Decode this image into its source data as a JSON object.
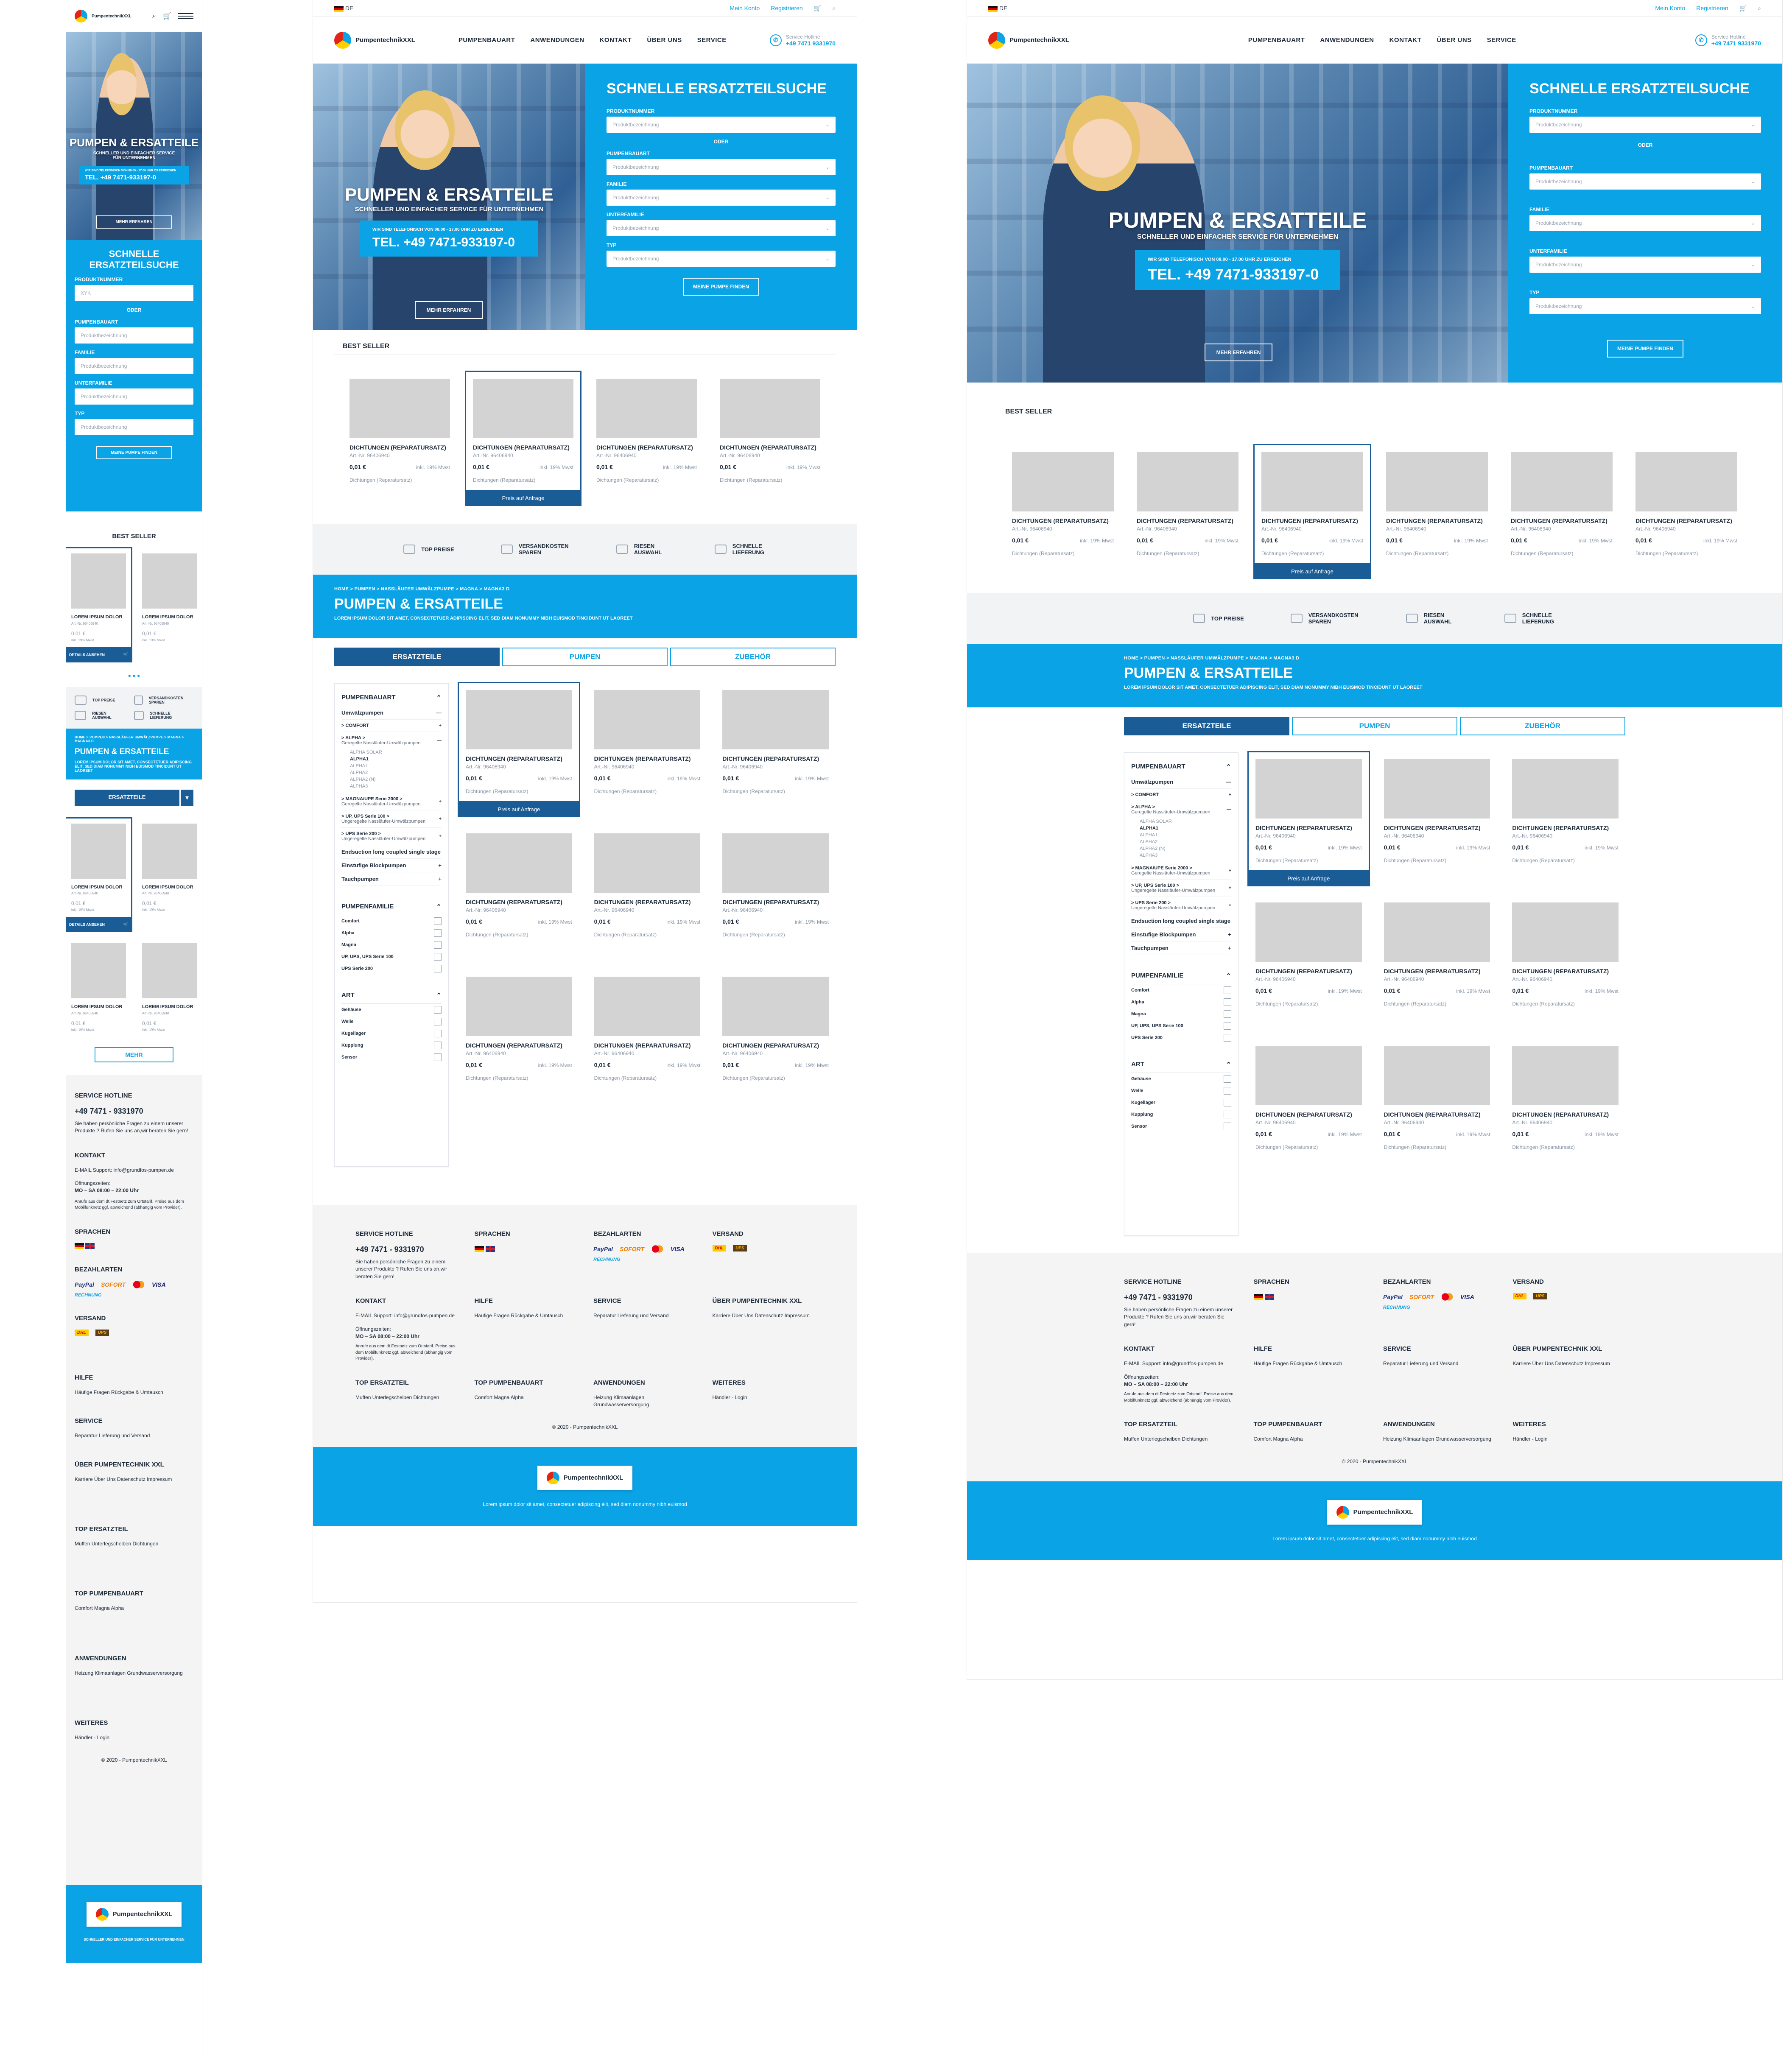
{
  "header": {
    "lang": "DE",
    "my_account": "Mein Konto",
    "register": "Registrieren",
    "brand": "PumpentechnikXXL",
    "nav": [
      "PUMPENBAUART",
      "ANWENDUNGEN",
      "KONTAKT",
      "ÜBER UNS",
      "SERVICE"
    ],
    "hotline_label": "Service Hotline",
    "hotline_number": "+49 7471 9331970"
  },
  "hero": {
    "title": "PUMPEN & ERSATTEILE",
    "subtitle": "SCHNELLER UND EINFACHER SERVICE FÜR UNTERNEHMEN",
    "call_note": "WIR SIND TELEFONISCH VON 08.00 - 17.00 UHR ZU ERREICHEN",
    "call_number": "TEL. +49 7471-933197-0",
    "more_button": "MEHR ERFAHREN"
  },
  "search": {
    "title": "SCHNELLE ERSATZTEILSUCHE",
    "mobile_title": "SCHNELLE ERSATZTEILSUCHE",
    "product_no_label": "PRODUKTNUMMER",
    "or": "ODER",
    "fields": [
      {
        "label": "PUMPENBAUART",
        "placeholder": "Produktbezeichnung"
      },
      {
        "label": "FAMILIE",
        "placeholder": "Produktbezeichnung"
      },
      {
        "label": "UNTERFAMILIE",
        "placeholder": "Produktbezeichnung"
      },
      {
        "label": "TYP",
        "placeholder": "Produktbezeichnung"
      }
    ],
    "placeholder": "Produktbezeichnung",
    "mobile_placeholder": "XYK",
    "button": "MEINE PUMPE FINDEN"
  },
  "bestseller": {
    "title": "BEST SELLER",
    "mobile_title": "BEST SELLER",
    "product": {
      "name": "DICHTUNGEN (REPARATURSATZ)",
      "article": "Art.-Nr. 96406940",
      "price": "0,01 €",
      "tax": "inkl. 19% Mwst",
      "category": "Dichtungen (Reparatursatz)",
      "request": "Preis auf Anfrage"
    },
    "mobile_product": {
      "name": "LOREM IPSUM DOLOR",
      "article": "Art.-Nr. 96406940",
      "price": "0,01 €",
      "tax": "inkl. 19% Mwst",
      "details": "DETAILS ANSEHEN"
    }
  },
  "usp": [
    "TOP PREISE",
    "VERSANDKOSTEN SPAREN",
    "RIESEN AUSWAHL",
    "SCHNELLE LIEFERUNG"
  ],
  "category": {
    "breadcrumb": "HOME > PUMPEN > NASSLÄUFER UMWÄLZPUMPE > MAGNA > MAGNA3 D",
    "title": "PUMPEN & ERSATTEILE",
    "text": "LOREM IPSUM DOLOR SIT AMET, CONSECTETUER ADIPISCING ELIT, SED DIAM NONUMMY NIBH EUISMOD TINCIDUNT UT LAOREET",
    "tabs": [
      "ERSATZTEILE",
      "PUMPEN",
      "ZUBEHÖR"
    ],
    "more": "MEHR"
  },
  "filters": {
    "pumpenbauart": "PUMPENBAUART",
    "umwalz": "Umwälzpumpen",
    "comfort": "> COMFORT",
    "alpha": "> ALPHA >",
    "alpha_sub": "Geregelte Nassläufer-Umwälzpumpen",
    "alpha_items": [
      "ALPHA SOLAR",
      "ALPHA1",
      "ALPHA L",
      "ALPHA2",
      "ALPHA2 (N)",
      "ALPHA3"
    ],
    "magna": "> MAGNA/UPE Serie 2000 >",
    "magna_sub": "Geregelte Nassläufer-Umwälzpumpen",
    "up100": "> UP, UPS Serie 100 >",
    "up100_sub": "Ungeregelte Nassläufer-Umwälzpumpen",
    "ups200": "> UPS Serie 200 >",
    "ups200_sub": "Ungeregelte Nassläufer-Umwälzpumpen",
    "endsuction": "Endsuction long coupled single stage",
    "einstufig": "Einstufige Blockpumpen",
    "tauch": "Tauchpumpen",
    "familie": "PUMPENFAMILIE",
    "familie_items": [
      "Comfort",
      "Alpha",
      "Magna",
      "UP, UPS, UPS Serie 100",
      "UPS Serie 200"
    ],
    "art": "ART",
    "art_items": [
      "Gehäuse",
      "Welle",
      "Kugellager",
      "Kupplung",
      "Sensor"
    ]
  },
  "footer": {
    "hotline_title": "SERVICE HOTLINE",
    "hotline": "+49 7471 - 9331970",
    "hotline_text": "Sie haben persönliche Fragen zu einem unserer Produkte ? Rufen Sie uns an,wir beraten Sie gern!",
    "languages": "SPRACHEN",
    "payment": "BEZAHLARTEN",
    "pay_items": [
      "PayPal",
      "SOFORT",
      "VISA",
      "RECHNUNG"
    ],
    "shipping": "VERSAND",
    "ship_items": [
      "DHL",
      "UPS"
    ],
    "contact_title": "KONTAKT",
    "contact_text": "E-MAIL Support: info@grundfos-pumpen.de",
    "hours_label": "Öffnungszeiten:",
    "hours": "MO – SA 08:00 – 22:00 Uhr",
    "hours_note": "Anrufe aus dem dt.Festnetz zum Ortstarif. Preise aus dem Mobilfunknetz ggf. abweichend (abhängig vom Provider).",
    "help_title": "HILFE",
    "help_items": "Häufige Fragen Rückgabe & Umtausch",
    "service_title": "SERVICE",
    "service_items": "Reparatur Lieferung und Versand",
    "about_title": "ÜBER PUMPENTECHNIK XXL",
    "about_items": "Karriere Über Uns Datenschutz Impressum",
    "top_spare": "TOP ERSATZTEIL",
    "top_spare_items": "Muffen Unterlegscheiben Dichtungen",
    "top_pump": "TOP PUMPENBAUART",
    "top_pump_items": "Comfort Magna Alpha",
    "apps": "ANWENDUNGEN",
    "apps_items": "Heizung Klimaanlagen Grundwasserversorgung",
    "more": "WEITERES",
    "more_items": "Händler - Login",
    "copyright": "© 2020 - PumpentechnikXXL",
    "band_text": "Lorem ipsum dolor sit amet, consectetuer adipiscing elit, sed diam nonummy nibh euismod",
    "band_text_mobile": "SCHNELLER UND EINFACHER SERVICE FÜR UNTERNEHMEN"
  }
}
